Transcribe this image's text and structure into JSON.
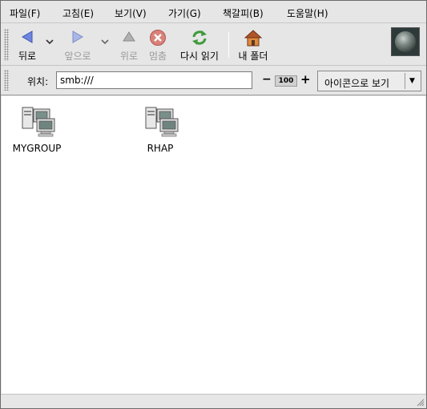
{
  "menubar": {
    "items": [
      "파일(F)",
      "고침(E)",
      "보기(V)",
      "가기(G)",
      "책갈피(B)",
      "도움말(H)"
    ]
  },
  "toolbar": {
    "back_label": "뒤로",
    "forward_label": "앞으로",
    "up_label": "위로",
    "stop_label": "멈춤",
    "reload_label": "다시 읽기",
    "home_label": "내 폴더"
  },
  "location": {
    "label": "위치:",
    "value": "smb:///",
    "zoom_minus": "−",
    "zoom_level": "100",
    "zoom_plus": "+",
    "view_mode": "아이콘으로 보기"
  },
  "content": {
    "items": [
      {
        "name": "MYGROUP",
        "icon": "network-workgroup-icon"
      },
      {
        "name": "RHAP",
        "icon": "network-workgroup-icon"
      }
    ]
  },
  "colors": {
    "window_bg": "#e6e6e6",
    "content_bg": "#ffffff",
    "nav_arrow": "#4a63c4",
    "stop_red": "#c0392b",
    "reload_green": "#3f9a3a",
    "home_orange": "#d2691e"
  }
}
